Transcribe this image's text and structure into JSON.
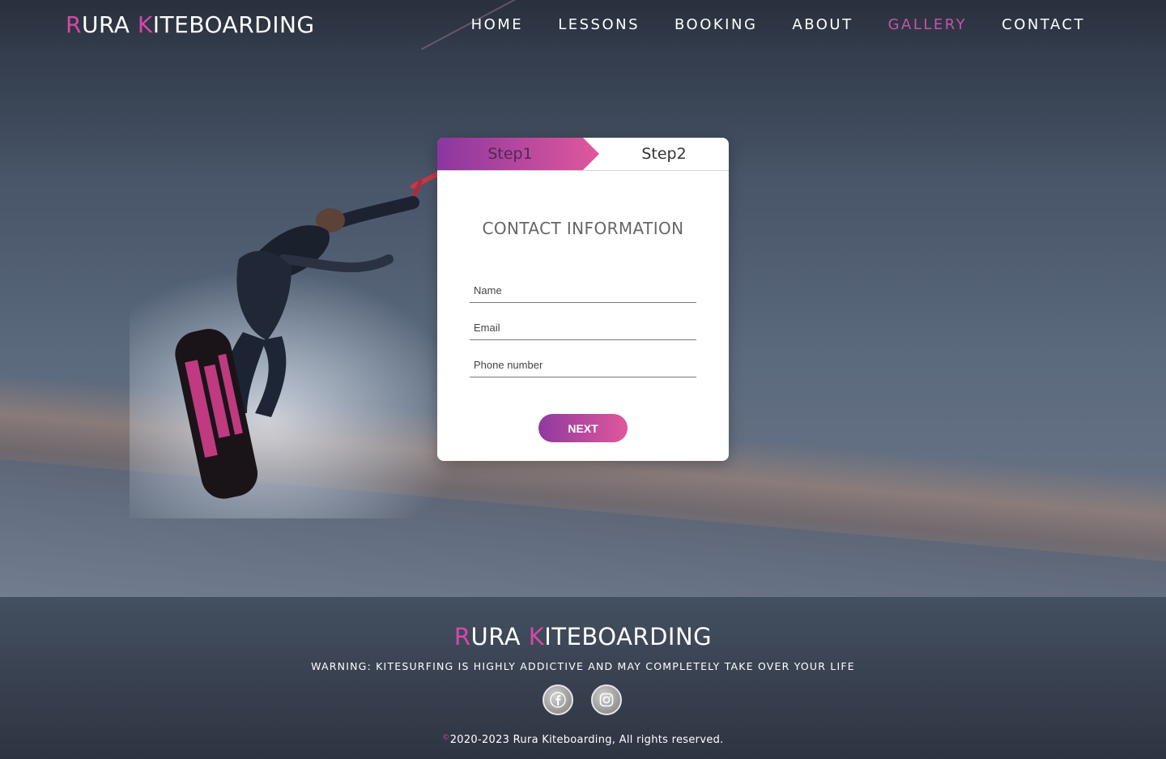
{
  "brand": {
    "first_initial": "R",
    "first_rest": "URA ",
    "second_initial": "K",
    "second_rest": "ITEBOARDING"
  },
  "nav": {
    "items": [
      {
        "label": "HOME"
      },
      {
        "label": "LESSONS"
      },
      {
        "label": "BOOKING"
      },
      {
        "label": "ABOUT"
      },
      {
        "label": "GALLERY",
        "active": true
      },
      {
        "label": "CONTACT"
      }
    ]
  },
  "form": {
    "steps": [
      "Step1",
      "Step2"
    ],
    "active_step": "Step1",
    "title": "CONTACT INFORMATION",
    "fields": [
      {
        "placeholder": "Name",
        "value": ""
      },
      {
        "placeholder": "Email",
        "value": ""
      },
      {
        "placeholder": "Phone number",
        "value": ""
      }
    ],
    "next_label": "NEXT"
  },
  "footer": {
    "brand": {
      "first_initial": "R",
      "first_rest": "URA ",
      "second_initial": "K",
      "second_rest": "ITEBOARDING"
    },
    "warning": "WARNING: KITESURFING IS HIGHLY ADDICTIVE AND MAY COMPLETELY TAKE OVER YOUR LIFE",
    "socials": [
      {
        "icon": "facebook-icon"
      },
      {
        "icon": "instagram-icon"
      }
    ],
    "copyright_symbol": "©",
    "copyright": "2020-2023 Rura Kiteboarding, All rights reserved."
  },
  "colors": {
    "accent": "#d648a8",
    "gradient_start": "#8b36a0",
    "gradient_end": "#e0589c",
    "nav_active": "#c653a8"
  }
}
